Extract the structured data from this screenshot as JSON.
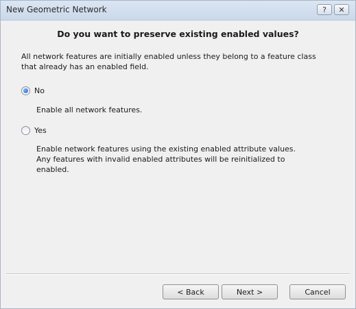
{
  "window": {
    "title": "New Geometric Network",
    "help_glyph": "?",
    "close_glyph": "✕"
  },
  "main": {
    "heading": "Do you want to preserve existing enabled values?",
    "description": "All network features are initially enabled unless they belong to a feature class that already has an enabled field.",
    "options": [
      {
        "label": "No",
        "selected": true,
        "description": "Enable all network features."
      },
      {
        "label": "Yes",
        "selected": false,
        "description": "Enable network features using the existing enabled attribute values. Any features with invalid enabled attributes will be reinitialized to enabled."
      }
    ]
  },
  "footer": {
    "back_label": "< Back",
    "next_label": "Next >",
    "cancel_label": "Cancel"
  },
  "icons": {
    "help": "help-icon",
    "close": "close-icon"
  }
}
